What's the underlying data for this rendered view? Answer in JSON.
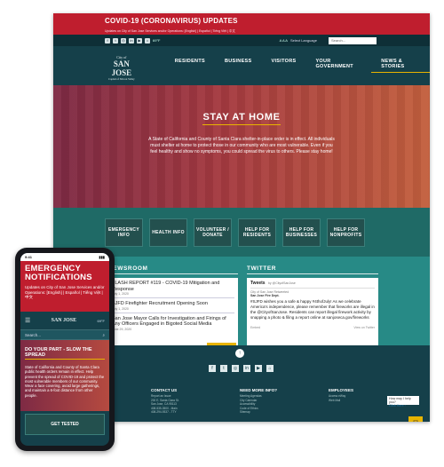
{
  "alert": {
    "title": "COVID-19 (CORONAVIRUS) UPDATES",
    "subtitle": "Updates on City of San Jose Services and/or Operations: [English] | Español | Tiếng Việt | 中文"
  },
  "utility": {
    "social_icons": [
      "facebook-icon",
      "twitter-icon",
      "instagram-icon",
      "linkedin-icon",
      "youtube-icon",
      "nextdoor-icon"
    ],
    "weather": "69°F",
    "text_size": "A A A",
    "language_label": "Select Language",
    "search_placeholder": "Search..."
  },
  "logo": {
    "line1": "City of",
    "line2": "SAN JOSE",
    "line3": "Capital of Silicon Valley"
  },
  "nav": {
    "items": [
      "RESIDENTS",
      "BUSINESS",
      "VISITORS",
      "YOUR GOVERNMENT",
      "NEWS & STORIES"
    ],
    "active_index": 4
  },
  "hero": {
    "title": "STAY AT HOME",
    "body": "A State of California and County of Santa Clara shelter-in-place order is in effect. All individuals must shelter at home to protect those in our community who are most vulnerable. Even if you feel healthy and show no symptoms, you could spread the virus to others. Please stay home!"
  },
  "tiles": [
    "EMERGENCY INFO",
    "HEALTH INFO",
    "VOLUNTEER / DONATE",
    "HELP FOR RESIDENTS",
    "HELP FOR BUSINESSES",
    "HELP FOR NONPROFITS"
  ],
  "newsroom": {
    "heading": "NEWSROOM",
    "items": [
      {
        "title": "FLASH REPORT #119 - COVID-19 Mitigation and Response",
        "date": "July 1, 2020"
      },
      {
        "title": "SJFD Firefighter Recruitment Opening Soon",
        "date": "July 1, 2020"
      },
      {
        "title": "San Jose Mayor Calls for Investigation and Firings of Any Officers Engaged in Bigoted Social Media",
        "date": "June 29, 2020"
      }
    ],
    "more_label": "MORE NEWS"
  },
  "twitter": {
    "heading": "TWITTER",
    "widget_title": "Tweets",
    "handle": "by @CityofSanJose",
    "source": "City of San Jose Retweeted",
    "account": "San Jose Fire Dept.",
    "text": "#SJFD wishes you a safe & happy #4thofJuly! As we celebrate America's independence, please remember that fireworks are illegal in the @CityofSanJose. Residents can report illegal firework activity by snapping a photo & filing a report online at sanjoseca.gov/fireworks",
    "embed": "Embed",
    "view": "View on Twitter"
  },
  "footer": {
    "to_top": "↑",
    "social_icons": [
      "facebook-icon",
      "twitter-icon",
      "instagram-icon",
      "linkedin-icon",
      "youtube-icon",
      "nextdoor-icon"
    ],
    "columns": [
      {
        "heading": "CONTACT US",
        "links": [
          "Report an Issue",
          "200 E. Santa Clara St.",
          "San Jose, CA 95113",
          "408-535-3500 - Main",
          "408-294-9337 - TTY"
        ]
      },
      {
        "heading": "NEED MORE INFO?",
        "links": [
          "Meeting Agendas",
          "City Calendar",
          "Accessibility",
          "Code of Ethics",
          "Sitemap"
        ]
      },
      {
        "heading": "EMPLOYEES",
        "links": [
          "Access eWay",
          "Web Mail"
        ]
      }
    ],
    "help_text": "How may I help you?",
    "help_sub": "Click Here ›"
  },
  "mobile": {
    "time": "9:41",
    "emergency_title": "EMERGENCY NOTIFICATIONS",
    "emergency_sub": "Updates on City of San Jose Services and/or Operations: [English] | Español | Tiếng Việt | 中文",
    "logo": "SAN JOSE",
    "weather": "69°F",
    "search_placeholder": "Search...",
    "hero_title": "DO YOUR PART - SLOW THE SPREAD",
    "hero_body": "State of California and County of Santa Clara public health orders remain in effect. Help prevent the spread of COVID-19 and protect the most vulnerable members of our community. Wear a face covering, avoid large gatherings, and maintain a 6-foot distance from other people.",
    "tile": "GET TESTED"
  }
}
